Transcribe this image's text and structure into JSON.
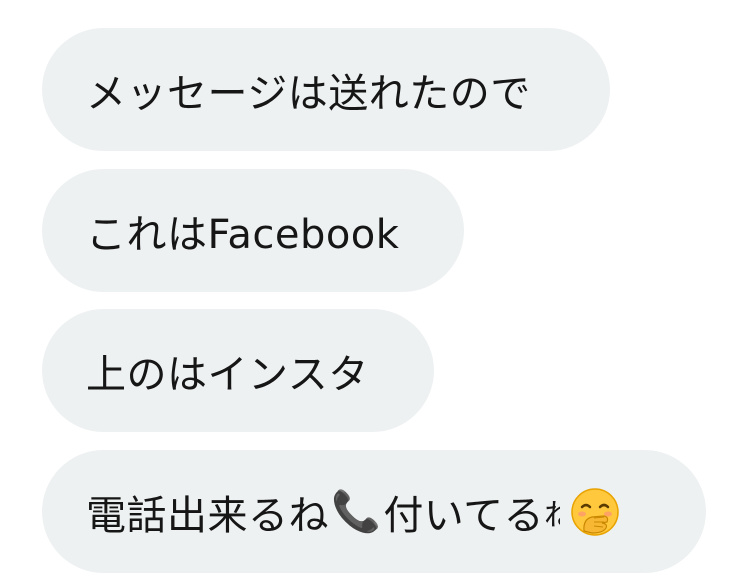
{
  "messages": [
    {
      "text": "メッセージは送れたので"
    },
    {
      "text": "これはFacebook"
    },
    {
      "text": "上のはインスタ"
    },
    {
      "text_before": "電話出来るね",
      "icon_phone": "telephone-receiver-icon",
      "phone_glyph": "📞",
      "text_after": "付いてる",
      "truncated_glyph": "ね",
      "emoji_icon": "face-with-hand-over-mouth-icon"
    }
  ],
  "colors": {
    "bubble_bg": "#eef1f2",
    "text": "#161616",
    "background": "#ffffff"
  }
}
